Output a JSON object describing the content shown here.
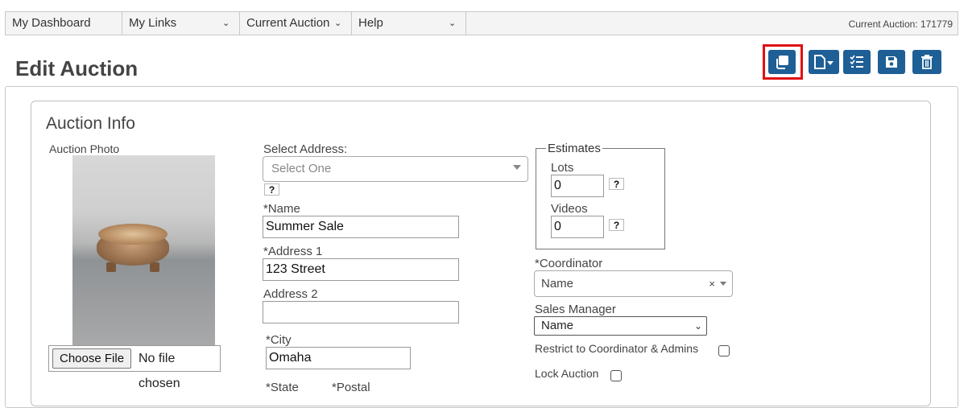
{
  "nav": {
    "dashboard": "My Dashboard",
    "links": "My Links",
    "current_auction": "Current Auction",
    "help": "Help",
    "current_auction_label": "Current Auction: 171779"
  },
  "page": {
    "title": "Edit Auction"
  },
  "toolbar": {
    "icons": [
      "copy-icon",
      "export-dropdown-icon",
      "checklist-icon",
      "save-icon",
      "delete-icon"
    ],
    "highlight_color": "#e01010",
    "button_color": "#1e5f96"
  },
  "auction_info": {
    "heading": "Auction Info",
    "photo_label": "Auction Photo",
    "file_button": "Choose File",
    "file_status": "No file chosen"
  },
  "address": {
    "label": "Select Address:",
    "placeholder": "Select One",
    "help": "?"
  },
  "fields": {
    "name_label": "*Name",
    "name_value": "Summer Sale",
    "address1_label": "*Address 1",
    "address1_value": "123 Street",
    "address2_label": "Address 2",
    "address2_value": "",
    "city_label": "*City",
    "city_value": "Omaha",
    "state_label": "*State",
    "postal_label": "*Postal"
  },
  "estimates": {
    "legend": "Estimates",
    "lots_label": "Lots",
    "lots_value": "0",
    "videos_label": "Videos",
    "videos_value": "0",
    "help": "?"
  },
  "coordinator": {
    "label": "*Coordinator",
    "value": "Name",
    "clear": "×"
  },
  "sales_manager": {
    "label": "Sales Manager",
    "value": "Name"
  },
  "options": {
    "restrict_label": "Restrict to Coordinator & Admins",
    "lock_label": "Lock Auction"
  }
}
